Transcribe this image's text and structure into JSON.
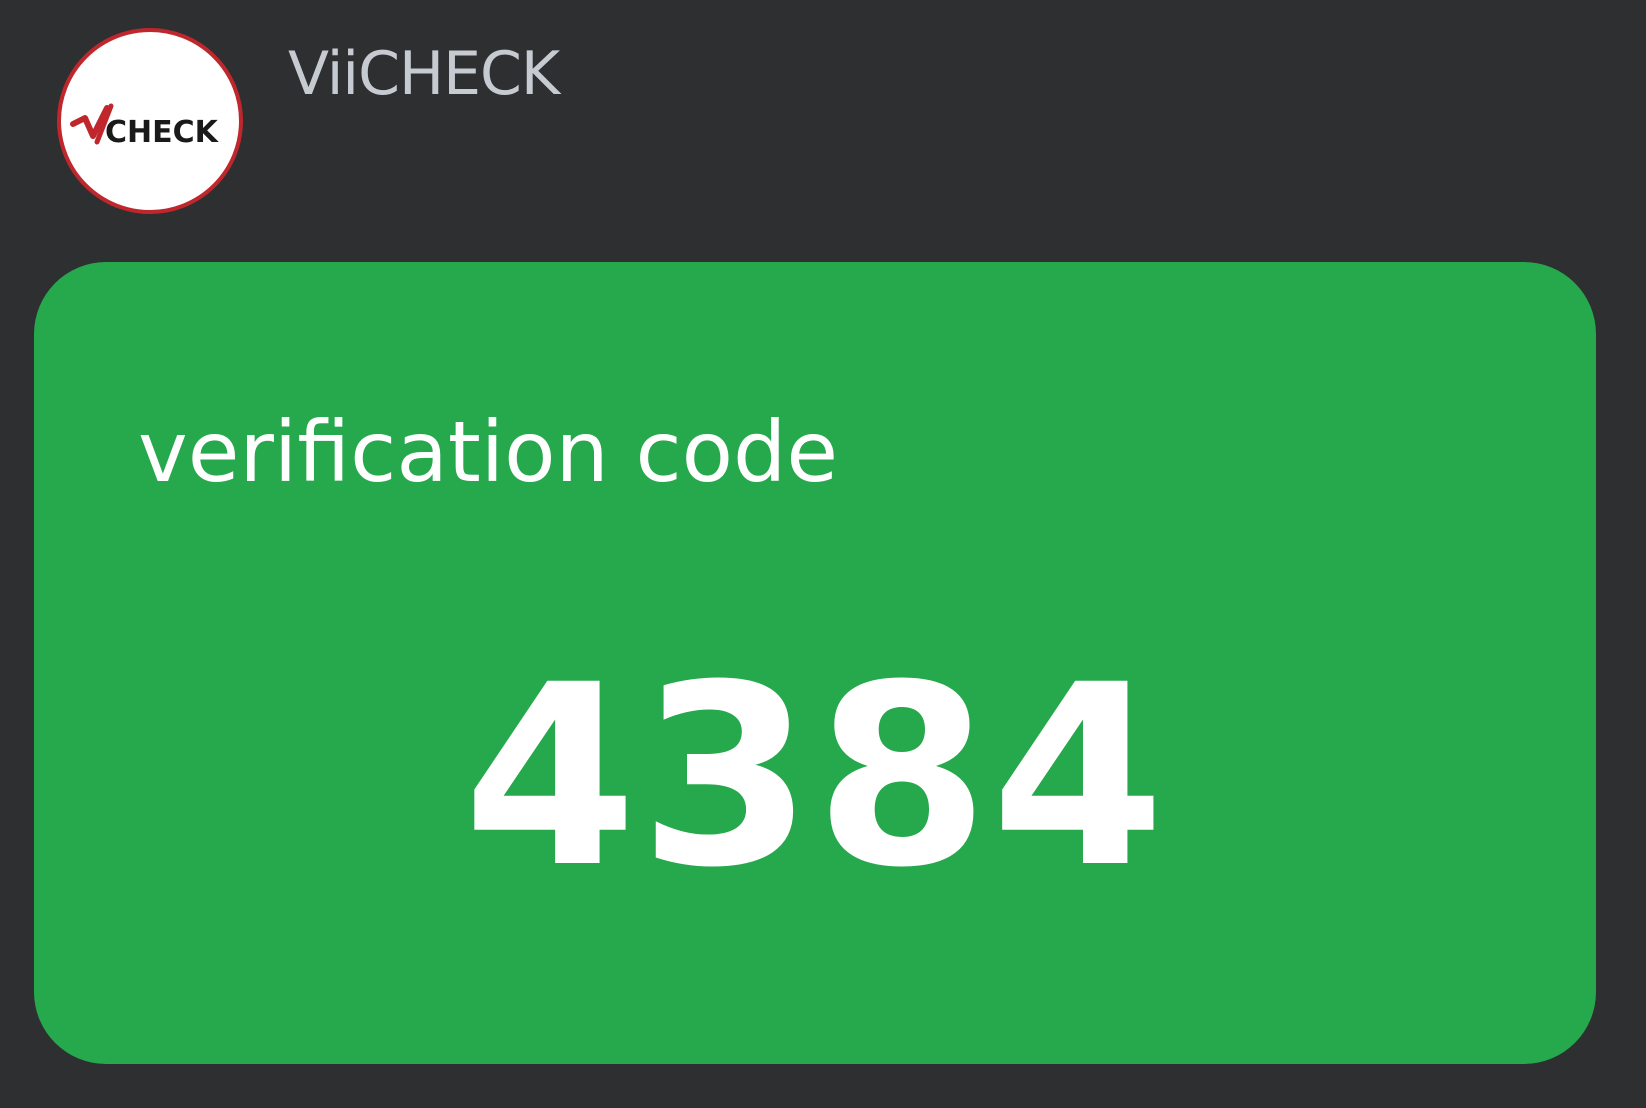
{
  "sender": {
    "name": "ViiCHECK",
    "avatar_logo_text": "CHECK",
    "avatar_icon": "viicheck-logo-icon"
  },
  "card": {
    "label": "verification code",
    "code": "4384"
  },
  "colors": {
    "background": "#2e2f31",
    "card": "#26a84c",
    "logo_red": "#c0272d",
    "text_light": "#ffffff",
    "name_text": "#c6cbd2"
  }
}
